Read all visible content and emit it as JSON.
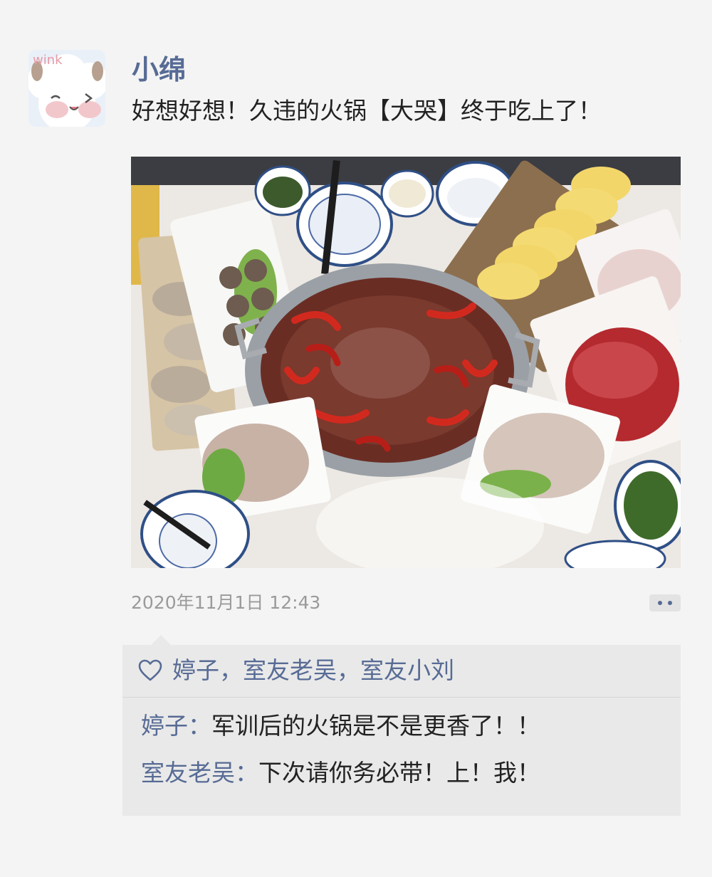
{
  "post": {
    "author": "小绵",
    "text": "好想好想！久违的火锅【大哭】终于吃上了！",
    "timestamp": "2020年11月1日 12:43",
    "avatar_label": "wink",
    "photo_subject": "hotpot"
  },
  "likes": {
    "icon": "heart-outline-icon",
    "names": "婷子，室友老吴，室友小刘"
  },
  "comments": [
    {
      "author": "婷子",
      "separator": "：",
      "text": "军训后的火锅是不是更香了！！"
    },
    {
      "author": "室友老吴",
      "separator": "：",
      "text": "下次请你务必带！上！我！"
    }
  ],
  "more_button": {
    "icon": "more-dots-icon"
  },
  "colors": {
    "link": "#576b95",
    "text": "#222222",
    "timestamp": "#9a9a9a",
    "background": "#f4f4f4",
    "comment_bg": "#e9e9e9"
  }
}
